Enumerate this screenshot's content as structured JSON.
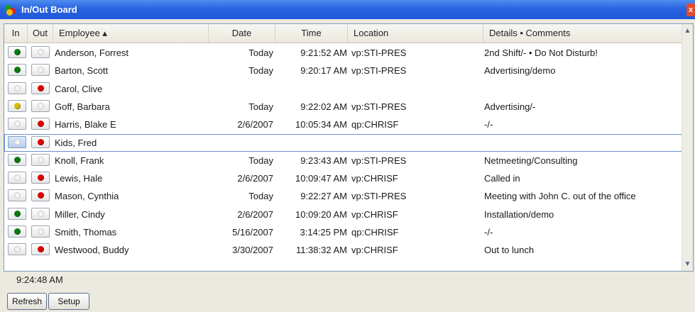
{
  "window": {
    "title": "In/Out Board",
    "close_glyph": "x"
  },
  "colors": {
    "in_green": "#0b7a12",
    "away_yellow": "#d6c000",
    "out_red": "#e00000",
    "title_blue": "#2a64e0"
  },
  "columns": {
    "in": "In",
    "out": "Out",
    "employee": "Employee ▴",
    "date": "Date",
    "time": "Time",
    "location": "Location",
    "details": "Details • Comments"
  },
  "rows": [
    {
      "employee": "Anderson, Forrest",
      "status": "in",
      "date": "Today",
      "time": "9:21:52 AM",
      "location": "vp:STI-PRES",
      "details": "2nd Shift/- • Do Not Disturb!"
    },
    {
      "employee": "Barton, Scott",
      "status": "in",
      "date": "Today",
      "time": "9:20:17 AM",
      "location": "vp:STI-PRES",
      "details": "Advertising/demo"
    },
    {
      "employee": "Carol, Clive",
      "status": "out",
      "date": "",
      "time": "",
      "location": "",
      "details": ""
    },
    {
      "employee": "Goff, Barbara",
      "status": "away",
      "date": "Today",
      "time": "9:22:02 AM",
      "location": "vp:STI-PRES",
      "details": "Advertising/-"
    },
    {
      "employee": "Harris, Blake E",
      "status": "out",
      "date": "2/6/2007",
      "time": "10:05:34 AM",
      "location": "qp:CHRISF",
      "details": "-/-"
    },
    {
      "employee": "Kids, Fred",
      "status": "out",
      "selected": true,
      "date": "",
      "time": "",
      "location": "",
      "details": ""
    },
    {
      "employee": "Knoll, Frank",
      "status": "in",
      "date": "Today",
      "time": "9:23:43 AM",
      "location": "vp:STI-PRES",
      "details": "Netmeeting/Consulting"
    },
    {
      "employee": "Lewis, Hale",
      "status": "out",
      "date": "2/6/2007",
      "time": "10:09:47 AM",
      "location": "vp:CHRISF",
      "details": "Called in"
    },
    {
      "employee": "Mason, Cynthia",
      "status": "out",
      "date": "Today",
      "time": "9:22:27 AM",
      "location": "vp:STI-PRES",
      "details": "Meeting with John C. out of the office"
    },
    {
      "employee": "Miller, Cindy",
      "status": "in",
      "date": "2/6/2007",
      "time": "10:09:20 AM",
      "location": "vp:CHRISF",
      "details": "Installation/demo"
    },
    {
      "employee": "Smith, Thomas",
      "status": "in",
      "date": "5/16/2007",
      "time": "3:14:25 PM",
      "location": "qp:CHRISF",
      "details": "-/-"
    },
    {
      "employee": "Westwood, Buddy",
      "status": "out",
      "date": "3/30/2007",
      "time": "11:38:32 AM",
      "location": "vp:CHRISF",
      "details": "Out to lunch"
    }
  ],
  "status_bar": {
    "time": "9:24:48 AM"
  },
  "buttons": {
    "refresh": "Refresh",
    "setup": "Setup"
  }
}
